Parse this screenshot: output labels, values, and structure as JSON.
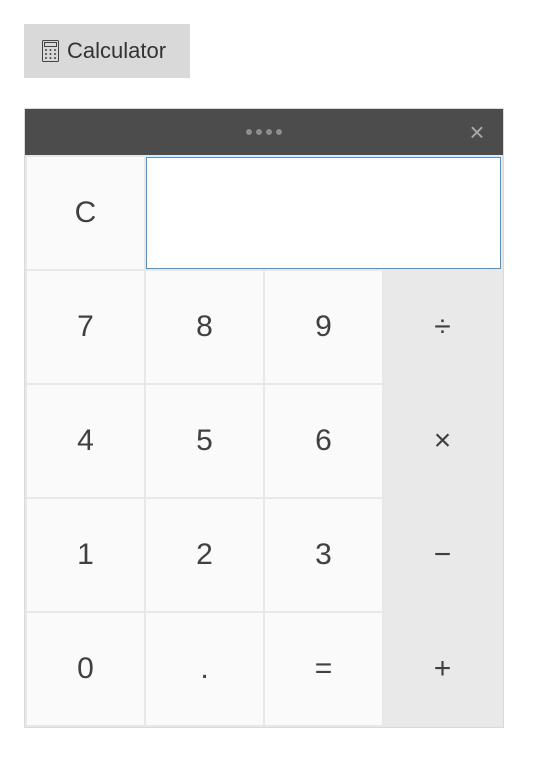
{
  "tab": {
    "label": "Calculator"
  },
  "display": {
    "value": "",
    "placeholder": ""
  },
  "keys": {
    "clear": "C",
    "n7": "7",
    "n8": "8",
    "n9": "9",
    "div": "÷",
    "n4": "4",
    "n5": "5",
    "n6": "6",
    "mul": "×",
    "n1": "1",
    "n2": "2",
    "n3": "3",
    "sub": "−",
    "n0": "0",
    "dot": ".",
    "eq": "=",
    "add": "+"
  }
}
